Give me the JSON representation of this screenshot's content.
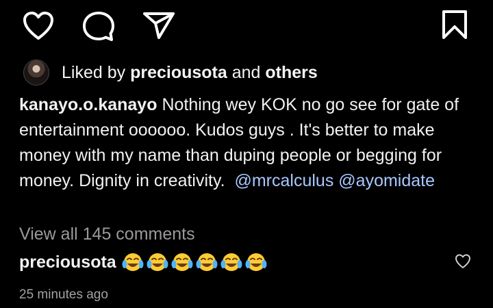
{
  "actions": {
    "like": "heart-icon",
    "comment": "comment-icon",
    "share": "send-icon",
    "save": "bookmark-icon"
  },
  "likes": {
    "prefix": "Liked by",
    "user": "preciousota",
    "conjunction": "and",
    "others": "others"
  },
  "caption": {
    "username": "kanayo.o.kanayo",
    "text": "Nothing wey KOK no go see for gate of entertainment oooooo. Kudos guys . It's better to make money with my name than duping people or begging for money. Dignity in creativity.",
    "mentions": [
      "@mrcalculus",
      "@ayomidate"
    ]
  },
  "view_all_comments": "View all 145 comments",
  "top_comment": {
    "username": "preciousota",
    "emoji_icons": [
      "laughing-crying-emoji",
      "laughing-crying-emoji",
      "laughing-crying-emoji",
      "laughing-crying-emoji",
      "laughing-crying-emoji",
      "laughing-crying-emoji"
    ]
  },
  "timestamp": "25 minutes ago",
  "colors": {
    "background": "#000000",
    "text": "#f2f2f2",
    "mention": "#a8c8ff",
    "secondary": "#9a9a9a",
    "emoji_face": "#ffcc33"
  }
}
